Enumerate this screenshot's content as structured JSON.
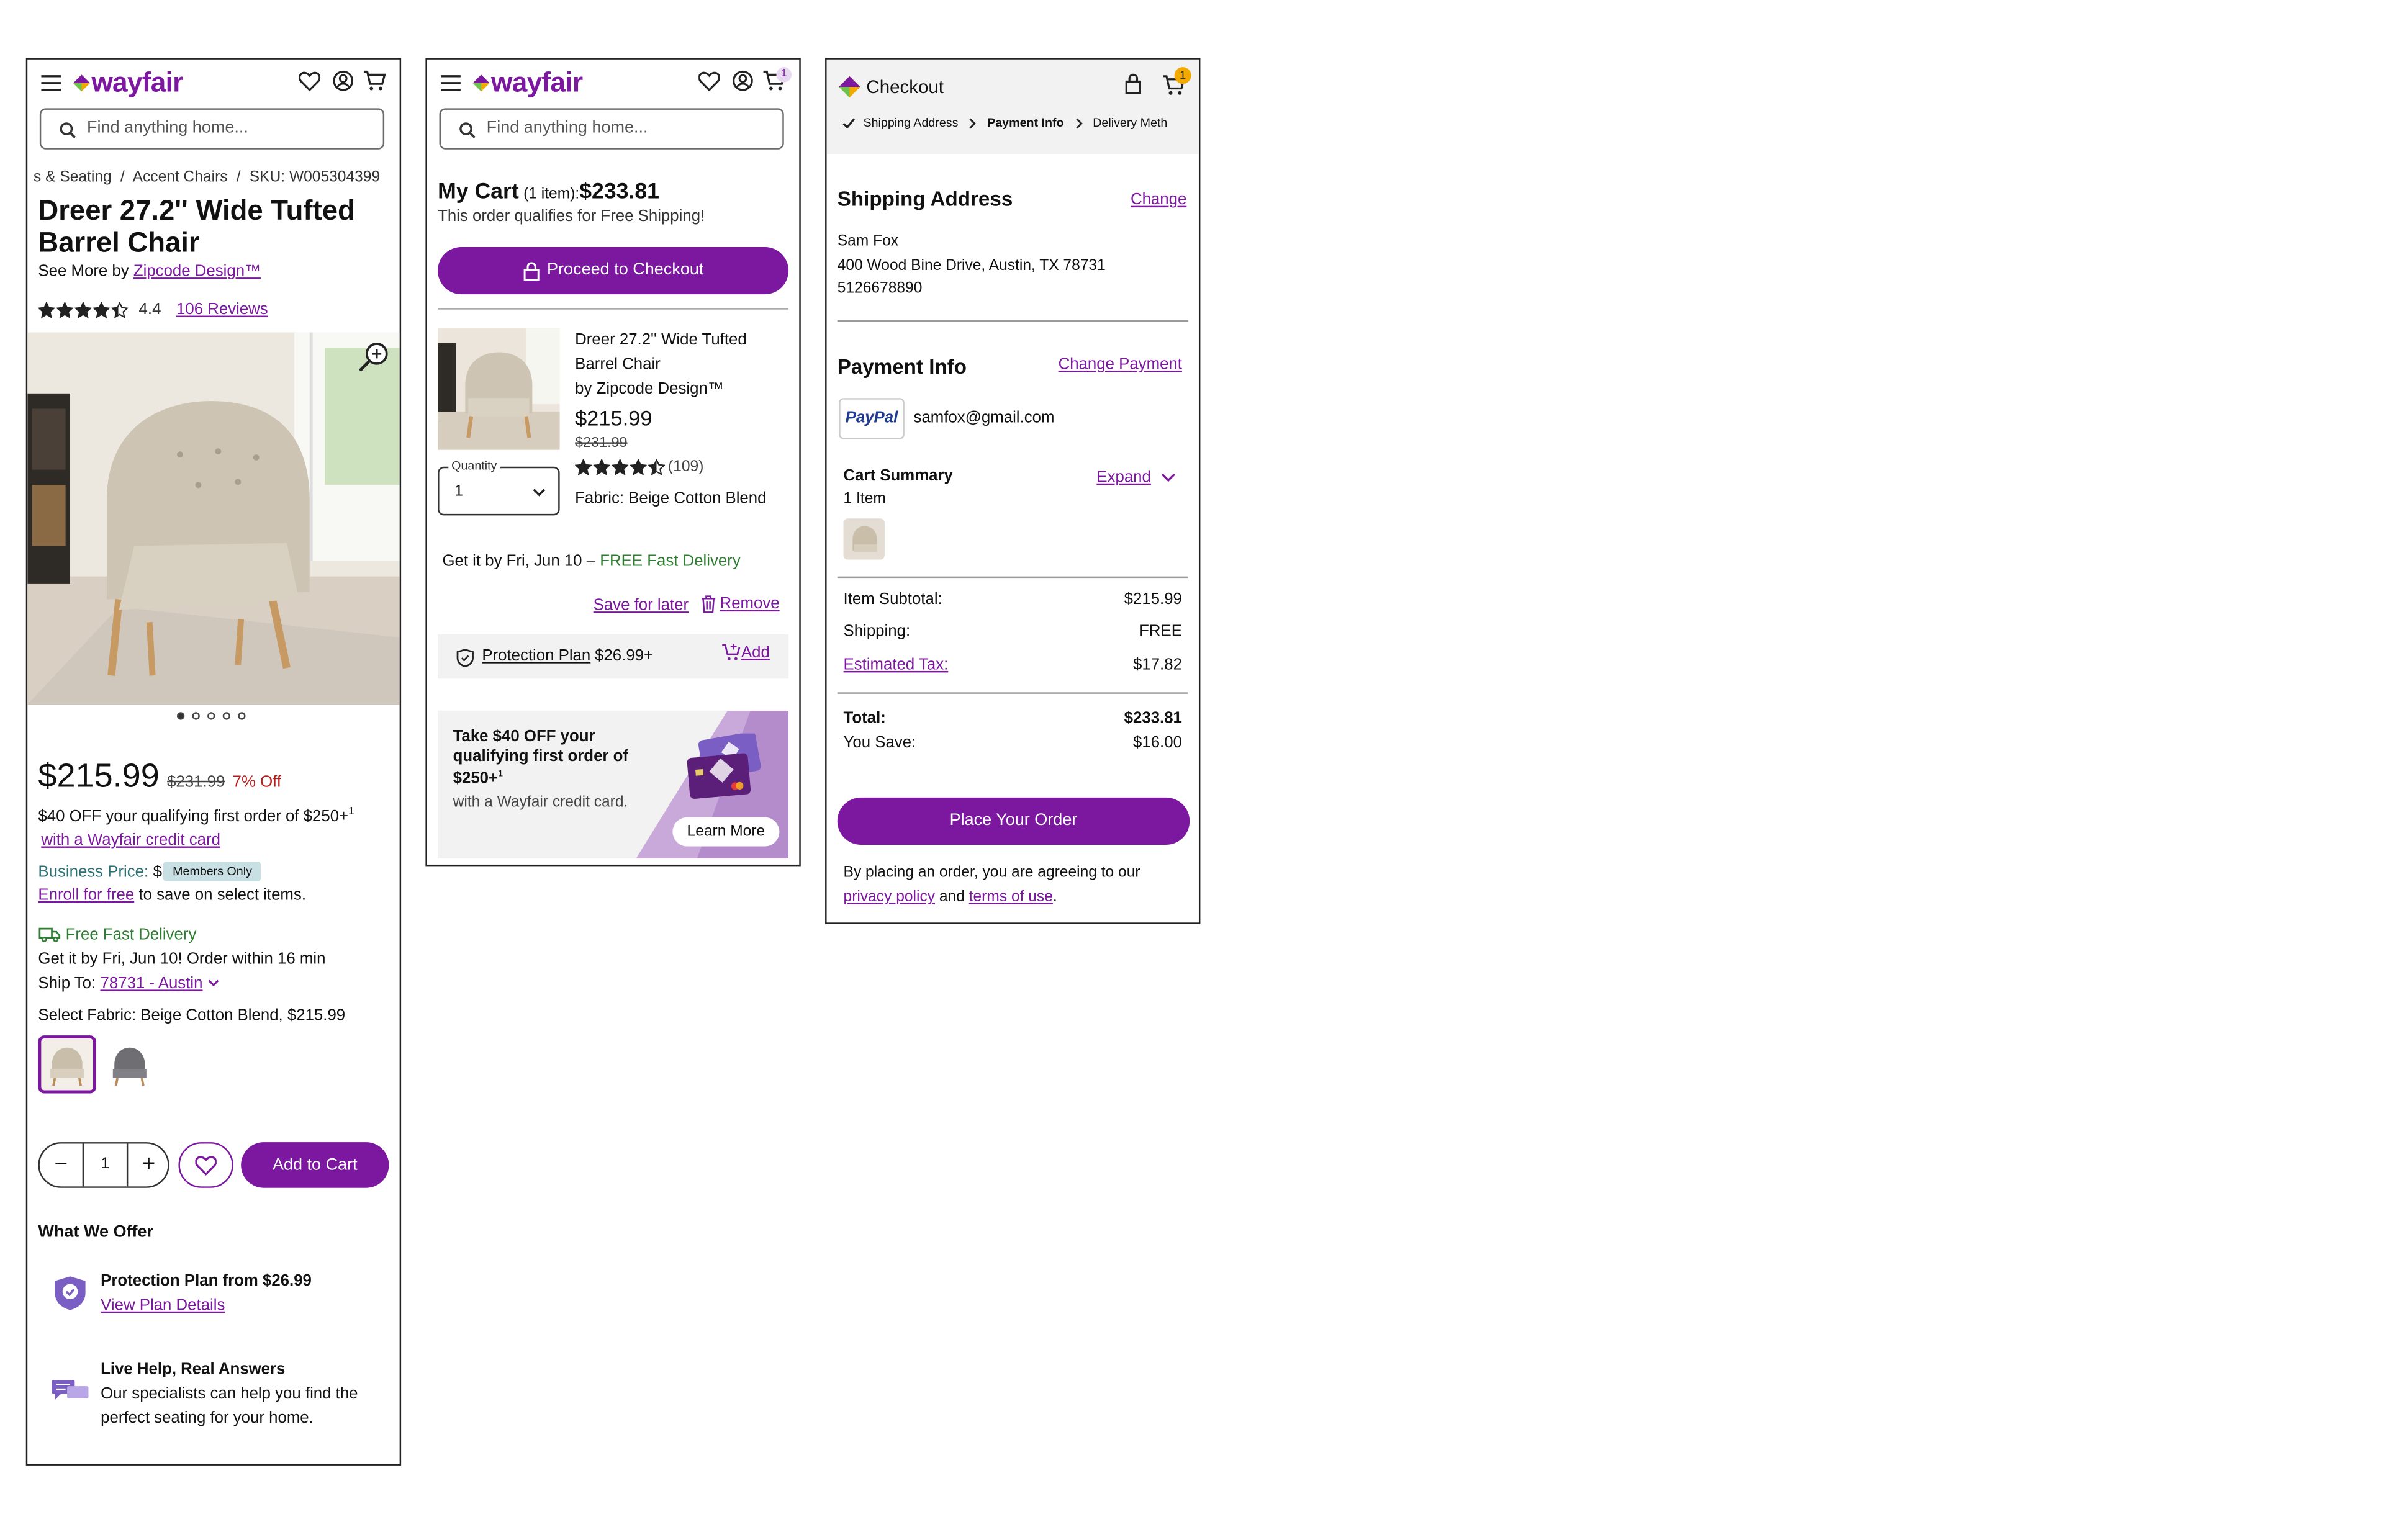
{
  "brand": {
    "name": "wayfair"
  },
  "colors": {
    "accent": "#7b189f",
    "success": "#2e7d32",
    "sale": "#b71c1c",
    "badge": "#f2a900"
  },
  "search": {
    "placeholder": "Find anything home..."
  },
  "product_page": {
    "breadcrumb": {
      "part1": "s & Seating",
      "sep": "/",
      "part2": "Accent Chairs",
      "sku": "SKU: W005304399"
    },
    "title": "Dreer 27.2'' Wide Tufted Barrel Chair",
    "see_more_prefix": "See More by",
    "brand_link": "Zipcode Design™",
    "rating": {
      "value": "4.4",
      "reviews_link": "106 Reviews",
      "stars": 4.4
    },
    "carousel": {
      "count": 5,
      "active": 0
    },
    "price": {
      "current": "$215.99",
      "original": "$231.99",
      "discount": "7% Off"
    },
    "credit_offer": "$40 OFF your qualifying first order of $250+",
    "credit_offer_sup": "1",
    "credit_link": "with a Wayfair credit card",
    "business_price_label": "Business Price:",
    "business_price_value": "$",
    "members_badge": "Members Only",
    "enroll_link": "Enroll for free",
    "enroll_text": "to save on select items.",
    "delivery_label": "Free Fast Delivery",
    "delivery_eta": "Get it by Fri, Jun 10! Order within 16 min",
    "ship_to_label": "Ship To:",
    "ship_to_link": "78731 - Austin",
    "fabric_label": "Select Fabric: Beige Cotton Blend, $215.99",
    "quantity": "1",
    "add_to_cart": "Add to Cart",
    "offer_heading": "What We Offer",
    "offer1_title": "Protection Plan from $26.99",
    "offer1_link": "View Plan Details",
    "offer2_title": "Live Help, Real Answers",
    "offer2_line1": "Our specialists can help you find the",
    "offer2_line2": "perfect seating for your home."
  },
  "cart_page": {
    "cart_badge": "1",
    "title": "My Cart",
    "item_count": "(1 item):",
    "total": "$233.81",
    "free_shipping": "This order qualifies for Free Shipping!",
    "checkout_button": "Proceed to Checkout",
    "item_name_line1": "Dreer 27.2'' Wide Tufted",
    "item_name_line2": "Barrel Chair",
    "item_brand": "by Zipcode Design™",
    "item_price": "$215.99",
    "item_original": "$231.99",
    "item_reviews": "(109)",
    "item_stars": 4.5,
    "quantity_label": "Quantity",
    "quantity_value": "1",
    "fabric": "Fabric: Beige Cotton Blend",
    "delivery_prefix": "Get it by Fri, Jun 10 –",
    "delivery_free": "FREE Fast Delivery",
    "save_later": "Save for later",
    "remove": "Remove",
    "protection_link": "Protection Plan",
    "protection_price": "$26.99+",
    "protection_add": "Add",
    "promo_line1": "Take $40 OFF your",
    "promo_line2": "qualifying first order of",
    "promo_line3": "$250+",
    "promo_sup": "1",
    "promo_sub": "with a Wayfair credit card.",
    "learn_more": "Learn More"
  },
  "checkout_page": {
    "header_title": "Checkout",
    "cart_badge": "1",
    "steps": [
      "Shipping Address",
      "Payment Info",
      "Delivery Meth"
    ],
    "shipping_heading": "Shipping Address",
    "change": "Change",
    "address_name": "Sam Fox",
    "address_line": "400 Wood Bine Drive, Austin, TX 78731",
    "address_phone": "5126678890",
    "payment_heading": "Payment Info",
    "change_payment": "Change Payment",
    "paypal_logo": "PayPal",
    "paypal_email": "samfox@gmail.com",
    "cart_summary_heading": "Cart Summary",
    "expand": "Expand",
    "item_count": "1 Item",
    "subtotal_label": "Item Subtotal:",
    "subtotal_value": "$215.99",
    "shipping_label": "Shipping:",
    "shipping_value": "FREE",
    "tax_label": "Estimated Tax:",
    "tax_value": "$17.82",
    "total_label": "Total:",
    "total_value": "$233.81",
    "save_label": "You Save:",
    "save_value": "$16.00",
    "place_order": "Place Your Order",
    "legal_line1": "By placing an order, you are agreeing to our",
    "privacy_link": "privacy policy",
    "and": "and",
    "terms_link": "terms of use",
    "period": "."
  }
}
